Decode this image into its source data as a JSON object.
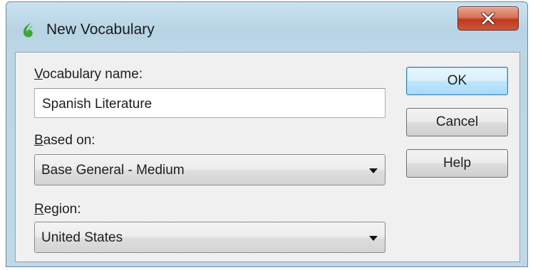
{
  "window": {
    "title": "New Vocabulary",
    "app_icon": "dragon-flame-icon",
    "close_icon": "close-icon"
  },
  "form": {
    "vocabulary_name": {
      "label_accel": "V",
      "label_rest": "ocabulary name:",
      "value": "Spanish Literature"
    },
    "based_on": {
      "label_accel": "B",
      "label_rest": "ased on:",
      "value": "Base General - Medium"
    },
    "region": {
      "label_accel": "R",
      "label_rest": "egion:",
      "value": "United States"
    }
  },
  "buttons": {
    "ok": "OK",
    "cancel": "Cancel",
    "help": "Help"
  },
  "colors": {
    "title_gradient": "#c9e2ef",
    "client_bg": "#f0f0f0",
    "close_red": "#c1391d",
    "default_button_border": "#3c7fb1",
    "icon_green": "#3da63a"
  }
}
